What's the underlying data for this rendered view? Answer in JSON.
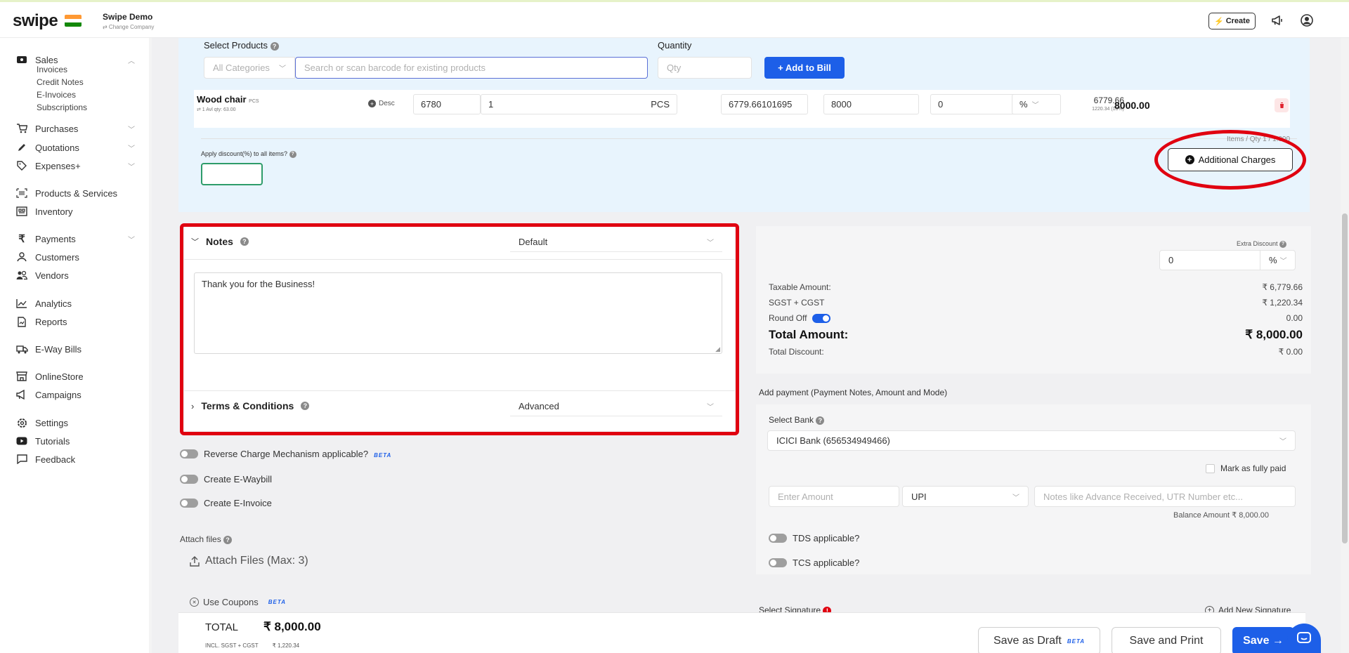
{
  "header": {
    "logo": "swipe",
    "company_name": "Swipe Demo",
    "company_sub": "⇄ Change Company",
    "create_label": "Create"
  },
  "sidebar": {
    "sales": "Sales",
    "sales_sub": [
      "Invoices",
      "Credit Notes",
      "E-Invoices",
      "Subscriptions"
    ],
    "purchases": "Purchases",
    "quotations": "Quotations",
    "expenses": "Expenses+",
    "products": "Products & Services",
    "inventory": "Inventory",
    "payments": "Payments",
    "customers": "Customers",
    "vendors": "Vendors",
    "analytics": "Analytics",
    "reports": "Reports",
    "eway": "E-Way Bills",
    "onlinestore": "OnlineStore",
    "campaigns": "Campaigns",
    "settings": "Settings",
    "tutorials": "Tutorials",
    "feedback": "Feedback"
  },
  "products": {
    "select_label": "Select Products",
    "quantity_label": "Quantity",
    "category": "All Categories",
    "search_placeholder": "Search or scan barcode for existing products",
    "qty_placeholder": "Qty",
    "add_btn": "+ Add to Bill",
    "discount_label": "Apply discount(%) to all items?",
    "items_qty": "Items / Qty 1 / 1.000",
    "additional_charges": "Additional Charges"
  },
  "item": {
    "name": "Wood chair",
    "unit_tag": "PCS",
    "avl": "⇄ 1 Avl qty: 63.00",
    "desc": "Desc",
    "price": "6780",
    "qty": "1",
    "unit": "PCS",
    "unit_price": "6779.66101695",
    "price_with_tax": "8000",
    "discount": "0",
    "discount_type": "%",
    "net": "6779.66",
    "tax_note": "1220.34 (18%)",
    "total": "8000.00"
  },
  "notes": {
    "title": "Notes",
    "template": "Default",
    "text": "Thank you for the Business!",
    "terms_title": "Terms & Conditions",
    "terms_template": "Advanced"
  },
  "options": {
    "reverse_charge": "Reverse Charge Mechanism applicable?",
    "beta": "BETA",
    "eway": "Create E-Waybill",
    "einvoice": "Create E-Invoice",
    "attach_label": "Attach files",
    "attach_btn": "Attach Files (Max: 3)",
    "coupons": "Use Coupons"
  },
  "summary": {
    "extra_discount_label": "Extra Discount",
    "extra_discount_value": "0",
    "extra_discount_type": "%",
    "taxable_label": "Taxable Amount:",
    "taxable_value": "₹ 6,779.66",
    "tax_label": "SGST + CGST",
    "tax_value": "₹ 1,220.34",
    "roundoff_label": "Round Off",
    "roundoff_value": "0.00",
    "total_label": "Total Amount:",
    "total_value": "₹ 8,000.00",
    "discount_label": "Total Discount:",
    "discount_value": "₹ 0.00"
  },
  "payment": {
    "title": "Add payment (Payment Notes, Amount and Mode)",
    "bank_label": "Select Bank",
    "bank_value": "ICICI Bank (656534949466)",
    "mark_paid": "Mark as fully paid",
    "amount_placeholder": "Enter Amount",
    "mode": "UPI",
    "notes_placeholder": "Notes like Advance Received, UTR Number etc...",
    "balance": "Balance Amount ₹ 8,000.00",
    "tds": "TDS applicable?",
    "tcs": "TCS applicable?",
    "signature_label": "Select Signature",
    "add_signature": "Add New Signature"
  },
  "footer": {
    "total_label": "TOTAL",
    "total_value": "₹ 8,000.00",
    "tax_label": "INCL. SGST + CGST",
    "tax_value": "₹ 1,220.34",
    "draft": "Save as Draft",
    "print": "Save and Print",
    "save": "Save →"
  }
}
